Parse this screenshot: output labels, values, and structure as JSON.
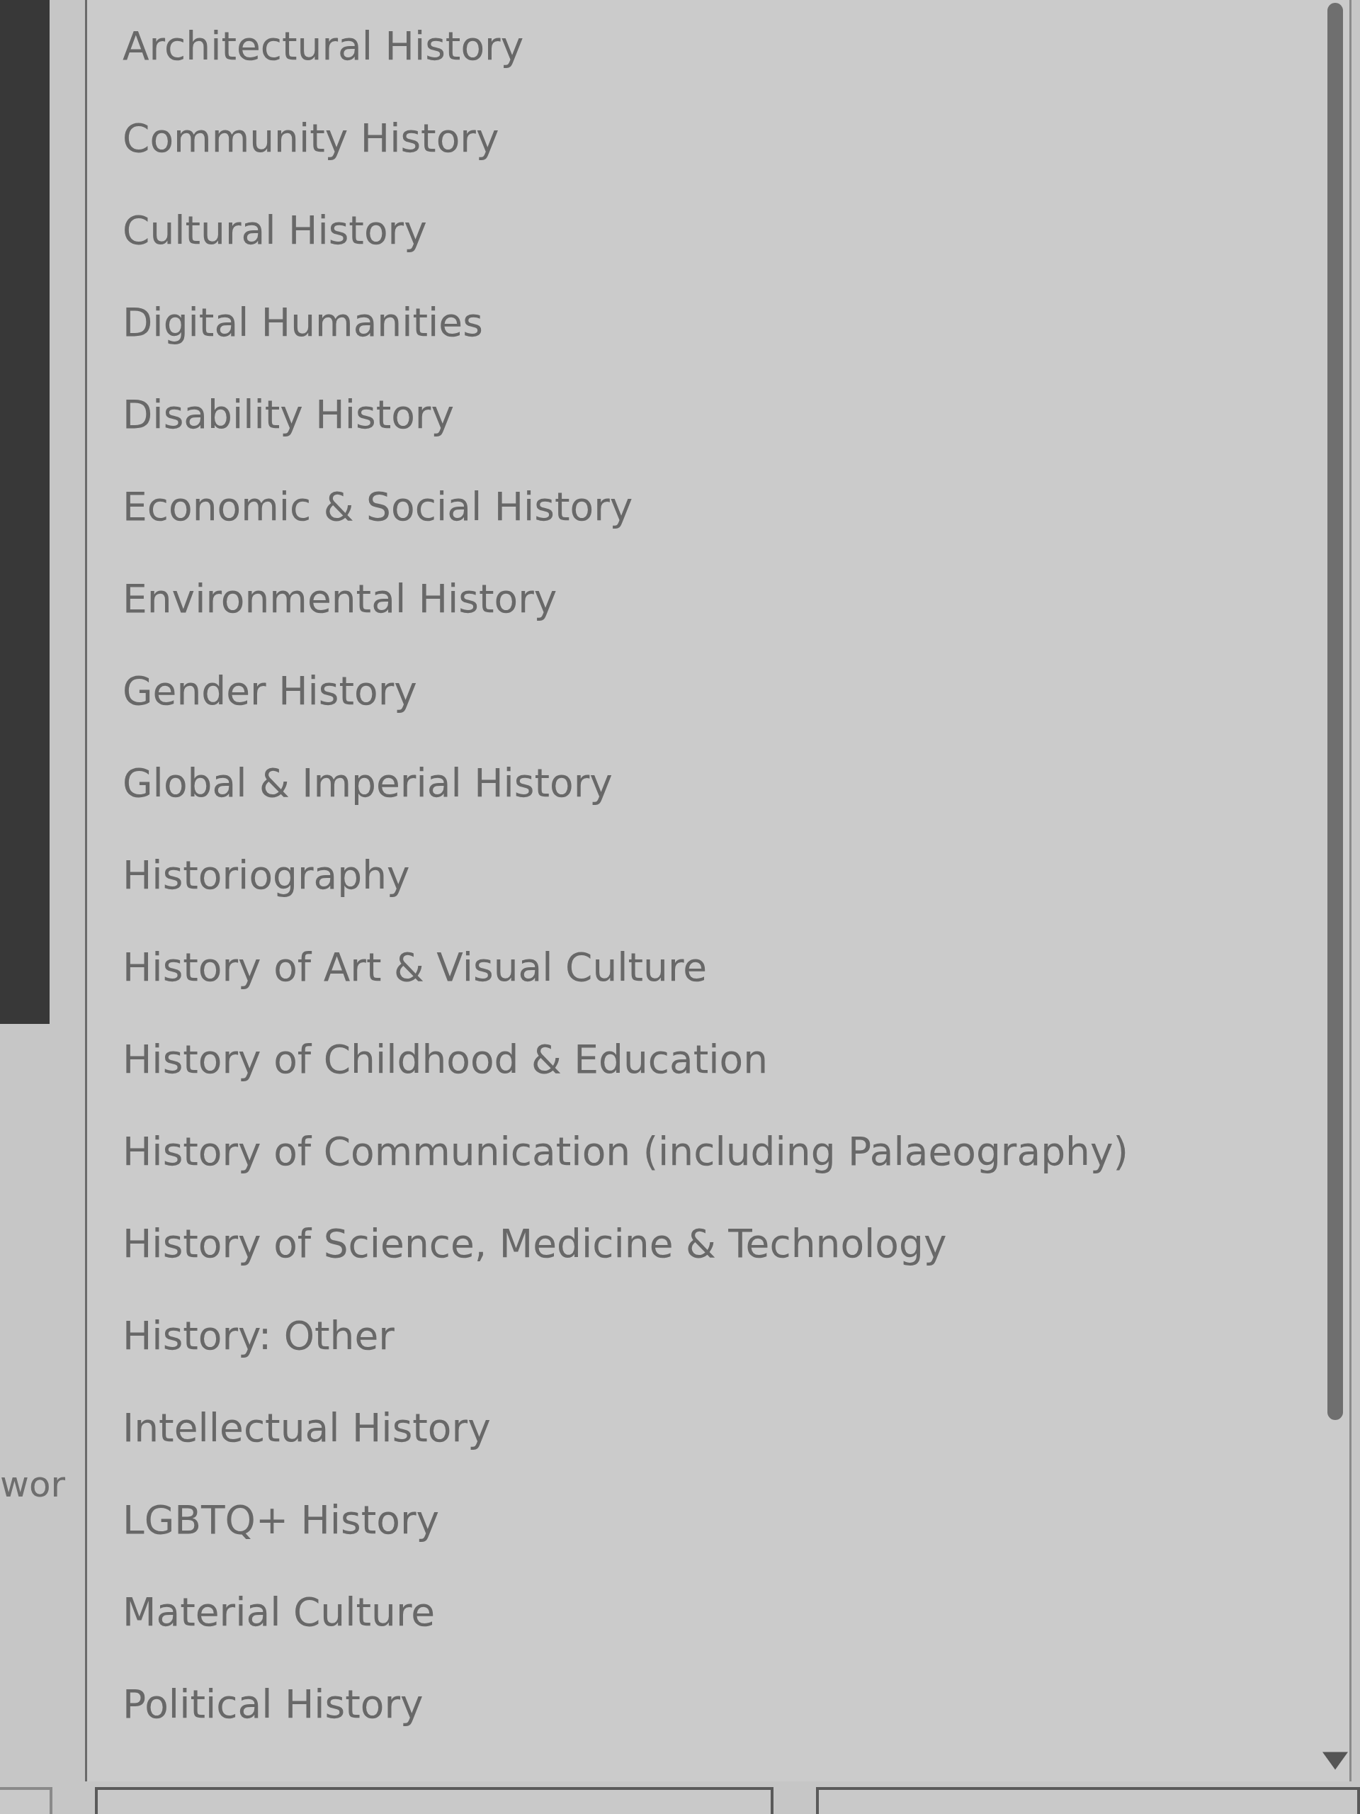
{
  "page": {
    "label_fragment": "wor"
  },
  "dropdown": {
    "options": [
      {
        "label": "Architectural History",
        "selected": false
      },
      {
        "label": "Community History",
        "selected": false
      },
      {
        "label": "Cultural History",
        "selected": false
      },
      {
        "label": "Digital Humanities",
        "selected": false
      },
      {
        "label": "Disability History",
        "selected": false
      },
      {
        "label": "Economic & Social History",
        "selected": false
      },
      {
        "label": "Environmental History",
        "selected": false
      },
      {
        "label": "Gender History",
        "selected": false
      },
      {
        "label": "Global & Imperial History",
        "selected": false
      },
      {
        "label": "Historiography",
        "selected": false
      },
      {
        "label": "History of Art & Visual Culture",
        "selected": false
      },
      {
        "label": "History of Childhood & Education",
        "selected": false
      },
      {
        "label": "History of Communication (including Palaeography)",
        "selected": false
      },
      {
        "label": "History of Science, Medicine & Technology",
        "selected": false
      },
      {
        "label": "History: Other",
        "selected": false
      },
      {
        "label": "Intellectual History",
        "selected": false
      },
      {
        "label": "LGBTQ+ History",
        "selected": false
      },
      {
        "label": "Material Culture",
        "selected": false
      },
      {
        "label": "Political History",
        "selected": false
      }
    ]
  }
}
